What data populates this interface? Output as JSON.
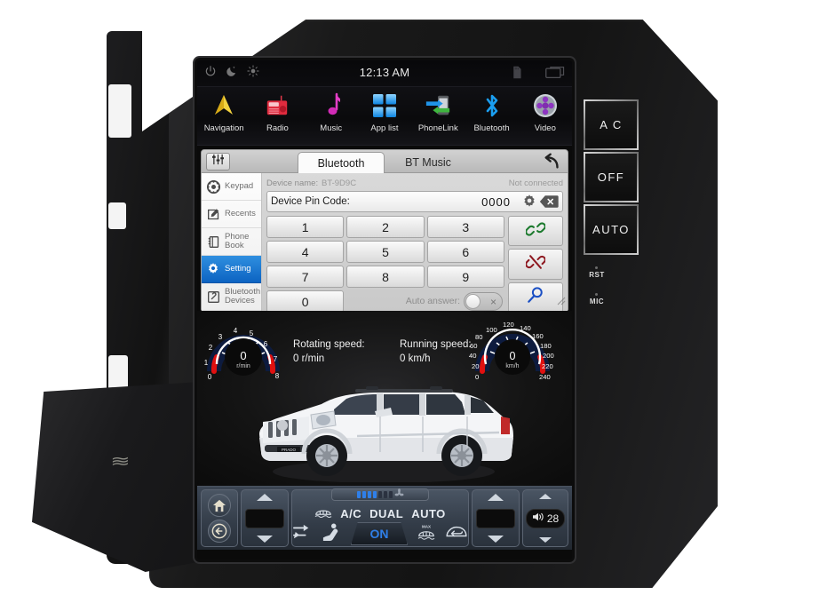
{
  "statusbar": {
    "time": "12:13 AM",
    "icons": [
      "power-icon",
      "night-mode-icon",
      "brightness-icon"
    ],
    "right_icons": [
      "sd-card-icon",
      "screen-off-icon"
    ]
  },
  "dock": {
    "items": [
      {
        "label": "Navigation",
        "icon": "navigation-arrow-icon"
      },
      {
        "label": "Radio",
        "icon": "radio-icon"
      },
      {
        "label": "Music",
        "icon": "music-note-icon"
      },
      {
        "label": "App list",
        "icon": "app-grid-icon"
      },
      {
        "label": "PhoneLink",
        "icon": "phonelink-icon"
      },
      {
        "label": "Bluetooth",
        "icon": "bluetooth-icon"
      },
      {
        "label": "Video",
        "icon": "video-reel-icon"
      }
    ]
  },
  "bluetooth_panel": {
    "eq_button": "equalizer-icon",
    "back_button": "back-arrow-icon",
    "tabs": [
      {
        "label": "Bluetooth",
        "active": true
      },
      {
        "label": "BT Music",
        "active": false
      }
    ],
    "sidebar": [
      {
        "label": "Keypad",
        "icon": "dial-pad-icon",
        "active": false
      },
      {
        "label": "Recents",
        "icon": "recents-icon",
        "active": false
      },
      {
        "label": "Phone Book",
        "icon": "phone-book-icon",
        "active": false
      },
      {
        "label": "Setting",
        "icon": "gear-icon",
        "active": true
      },
      {
        "label": "Bluetooth Devices",
        "icon": "bt-devices-icon",
        "active": false
      }
    ],
    "device_name_label": "Device name:",
    "device_name_value": "BT-9D9C",
    "connection_status": "Not connected",
    "pin_label": "Device Pin Code:",
    "pin_value": "0000",
    "pin_settings_icon": "gear-icon",
    "pin_backspace_icon": "backspace-icon",
    "keys": [
      "1",
      "2",
      "3",
      "4",
      "5",
      "6",
      "7",
      "8",
      "9",
      "0"
    ],
    "auto_answer_label": "Auto answer:",
    "auto_answer_state": "off",
    "auto_answer_x": "×",
    "actions": [
      {
        "icon": "link-connect-icon",
        "color": "#1c7a2e"
      },
      {
        "icon": "unlink-disconnect-icon",
        "color": "#8e1820"
      },
      {
        "icon": "search-icon",
        "color": "#1a4fc4"
      }
    ]
  },
  "gauges": {
    "rpm": {
      "value": "0",
      "unit": "r/min",
      "ticks": [
        "0",
        "1",
        "2",
        "3",
        "4",
        "5",
        "6",
        "7",
        "8"
      ],
      "readout_label": "Rotating speed:",
      "readout_value": "0 r/min"
    },
    "speed": {
      "value": "0",
      "unit": "km/h",
      "ticks": [
        "0",
        "20",
        "40",
        "60",
        "80",
        "100",
        "120",
        "140",
        "160",
        "180",
        "200",
        "220",
        "240"
      ],
      "readout_label": "Running speed:",
      "readout_value": "0 km/h"
    }
  },
  "car": {
    "badge": "PRADO",
    "color": "#ffffff"
  },
  "climate": {
    "home_icon": "home-icon",
    "back_icon": "back-circle-icon",
    "left_stepper": {
      "up": "arrow-up-icon",
      "down": "arrow-down-icon",
      "value": ""
    },
    "right_stepper": {
      "up": "arrow-up-icon",
      "down": "arrow-down-icon",
      "value": ""
    },
    "words": [
      "A/C",
      "DUAL",
      "AUTO"
    ],
    "on_badge": "ON",
    "on_color": "#2f7fe8",
    "icons": [
      "recirculate-icon",
      "front-defrost-icon",
      "seat-airflow-icon",
      "max-rear-defrost-icon",
      "fresh-air-icon"
    ],
    "fan_bars_on": 4,
    "fan_bars_total": 7,
    "volume": {
      "icon": "speaker-icon",
      "value": "28"
    }
  },
  "hard_buttons": [
    {
      "label": "A C"
    },
    {
      "label": "OFF"
    },
    {
      "label": "AUTO"
    }
  ],
  "micro_labels": [
    {
      "label": "RST"
    },
    {
      "label": "MIC"
    }
  ],
  "colors": {
    "accent_blue": "#0c63c2",
    "climate_blue": "#2f7fe8",
    "gauge_red": "#e01010",
    "bezel": "#1a1a1c"
  }
}
